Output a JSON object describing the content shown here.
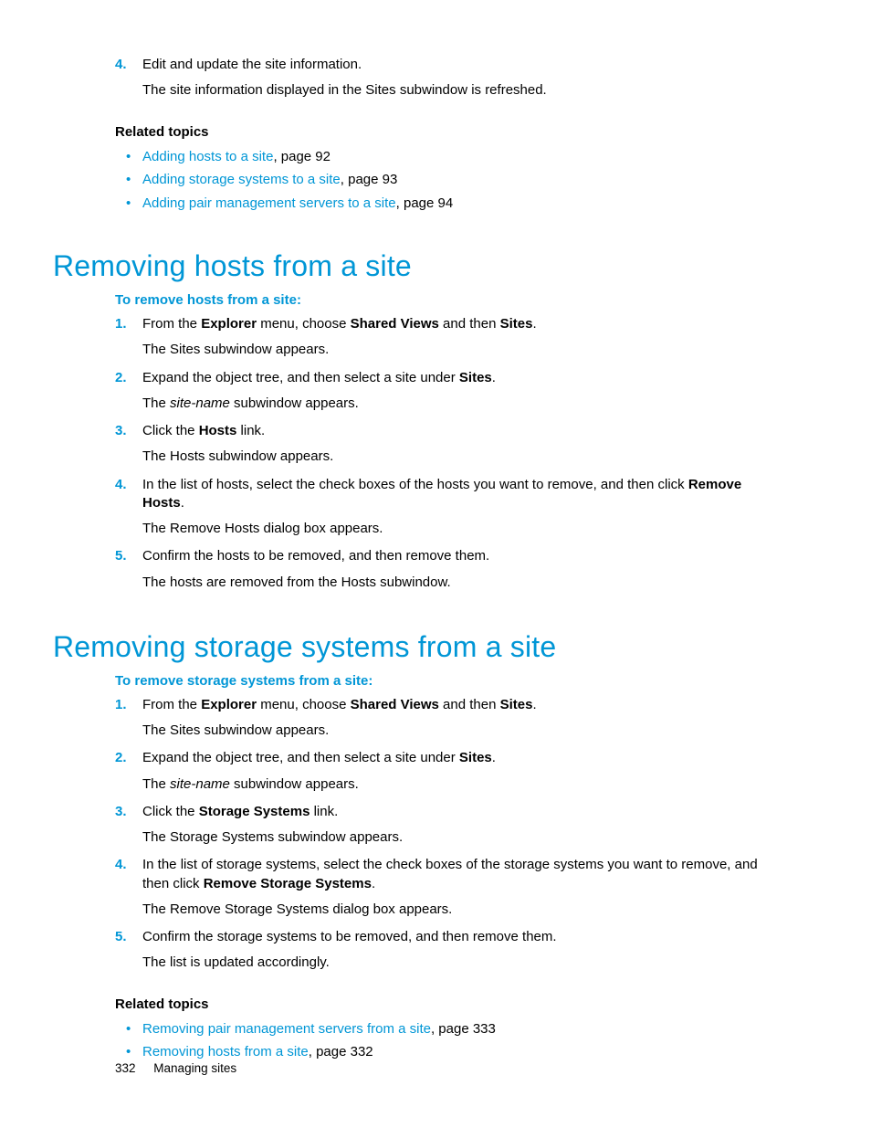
{
  "top_step": {
    "num": "4.",
    "text_a": "Edit and update the site information.",
    "result": "The site information displayed in the Sites subwindow is refreshed."
  },
  "rel1": {
    "heading": "Related topics",
    "items": [
      {
        "link": "Adding hosts to a site",
        "rest": ", page 92"
      },
      {
        "link": "Adding storage systems to a site",
        "rest": ", page 93"
      },
      {
        "link": "Adding pair management servers to a site",
        "rest": ", page 94"
      }
    ]
  },
  "sec1": {
    "title": "Removing hosts from a site",
    "intro": "To remove hosts from a site:",
    "steps": [
      {
        "num": "1.",
        "pre": "From the ",
        "b1": "Explorer",
        "mid": " menu, choose ",
        "b2": "Shared Views",
        "mid2": " and then ",
        "b3": "Sites",
        "post": ".",
        "result": "The Sites subwindow appears."
      },
      {
        "num": "2.",
        "pre": "Expand the object tree, and then select a site under ",
        "b1": "Sites",
        "post": ".",
        "result_pre": "The ",
        "result_i": "site-name",
        "result_post": " subwindow appears."
      },
      {
        "num": "3.",
        "pre": "Click the ",
        "b1": "Hosts",
        "post": " link.",
        "result": "The Hosts subwindow appears."
      },
      {
        "num": "4.",
        "pre": "In the list of hosts, select the check boxes of the hosts you want to remove, and then click ",
        "b1": "Remove Hosts",
        "post": ".",
        "result": "The Remove Hosts dialog box appears."
      },
      {
        "num": "5.",
        "pre": "Confirm the hosts to be removed, and then remove them.",
        "result": "The hosts are removed from the Hosts subwindow."
      }
    ]
  },
  "sec2": {
    "title": "Removing storage systems from a site",
    "intro": "To remove storage systems from a site:",
    "steps": [
      {
        "num": "1.",
        "pre": "From the ",
        "b1": "Explorer",
        "mid": " menu, choose ",
        "b2": "Shared Views",
        "mid2": " and then ",
        "b3": "Sites",
        "post": ".",
        "result": "The Sites subwindow appears."
      },
      {
        "num": "2.",
        "pre": "Expand the object tree, and then select a site under ",
        "b1": "Sites",
        "post": ".",
        "result_pre": "The ",
        "result_i": "site-name",
        "result_post": " subwindow appears."
      },
      {
        "num": "3.",
        "pre": "Click the ",
        "b1": "Storage Systems",
        "post": " link.",
        "result": "The Storage Systems subwindow appears."
      },
      {
        "num": "4.",
        "pre": "In the list of storage systems, select the check boxes of the storage systems you want to remove, and then click ",
        "b1": "Remove Storage Systems",
        "post": ".",
        "result": "The Remove Storage Systems dialog box appears."
      },
      {
        "num": "5.",
        "pre": "Confirm the storage systems to be removed, and then remove them.",
        "result": "The list is updated accordingly."
      }
    ]
  },
  "rel2": {
    "heading": "Related topics",
    "items": [
      {
        "link": "Removing pair management servers from a site",
        "rest": ", page 333"
      },
      {
        "link": "Removing hosts from a site",
        "rest": ", page 332"
      }
    ]
  },
  "footer": {
    "page": "332",
    "chapter": "Managing sites"
  }
}
